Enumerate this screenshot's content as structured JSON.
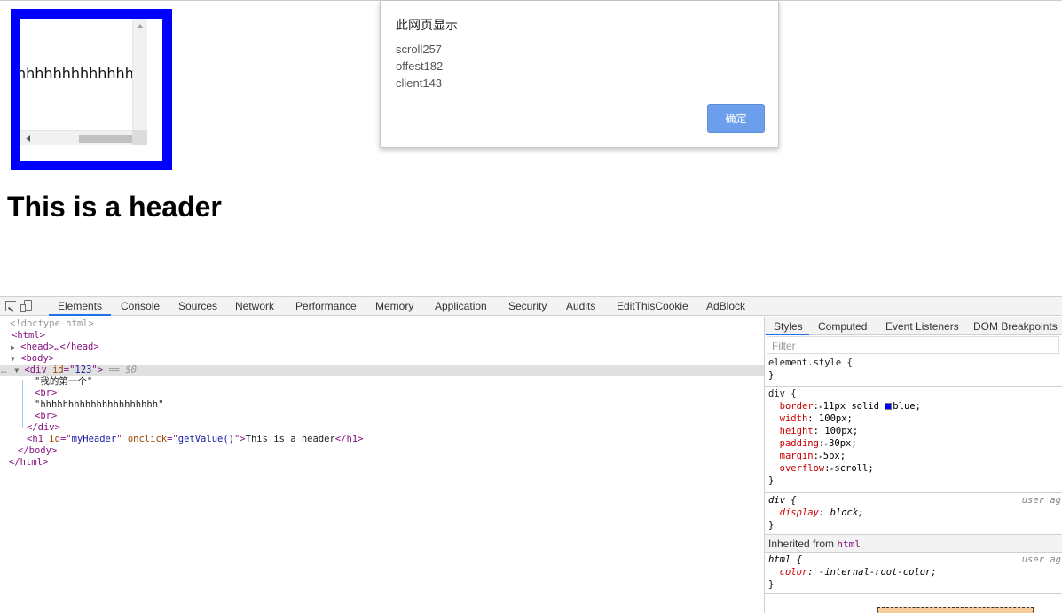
{
  "page": {
    "box_text": "hhhhhhhhhhhhh",
    "header": "This is a header"
  },
  "alert": {
    "title": "此网页显示",
    "lines": [
      "scroll257",
      "offest182",
      "client143"
    ],
    "ok_label": "确定"
  },
  "devtools": {
    "tabs": [
      "Elements",
      "Console",
      "Sources",
      "Network",
      "Performance",
      "Memory",
      "Application",
      "Security",
      "Audits",
      "EditThisCookie",
      "AdBlock"
    ],
    "active_tab": "Elements",
    "dom": {
      "doctype": "<!doctype html>",
      "html_open": "<html>",
      "head": "<head>…</head>",
      "body_open": "<body>",
      "div_id": "123",
      "div_suffix": "== $0",
      "text1": "\"我的第一个\"",
      "br": "<br>",
      "text2": "\"hhhhhhhhhhhhhhhhhhhhh\"",
      "div_close": "</div>",
      "h1_id": "myHeader",
      "h1_onclick": "getValue()",
      "h1_text": "This is a header",
      "body_close": "</body>",
      "html_close": "</html>"
    },
    "side_tabs": [
      "Styles",
      "Computed",
      "Event Listeners",
      "DOM Breakpoints"
    ],
    "filter_placeholder": "Filter",
    "styles": {
      "element_style": "element.style {",
      "div_rule": {
        "selector": "div {",
        "props": [
          {
            "name": "border",
            "value": "11px solid",
            "color_name": "blue;",
            "swatch": "#0000ff"
          },
          {
            "name": "width",
            "value": "100px;"
          },
          {
            "name": "height",
            "value": "100px;"
          },
          {
            "name": "padding",
            "value": "30px;"
          },
          {
            "name": "margin",
            "value": "5px;"
          },
          {
            "name": "overflow",
            "value": "scroll;"
          }
        ]
      },
      "ua_div": {
        "selector": "div {",
        "source": "user ag",
        "prop": "display",
        "value": "block;"
      },
      "inherited_label": "Inherited from",
      "inherited_tag": "html",
      "ua_html": {
        "selector": "html {",
        "source": "user ag",
        "prop": "color",
        "value": "-internal-root-color;"
      }
    }
  }
}
